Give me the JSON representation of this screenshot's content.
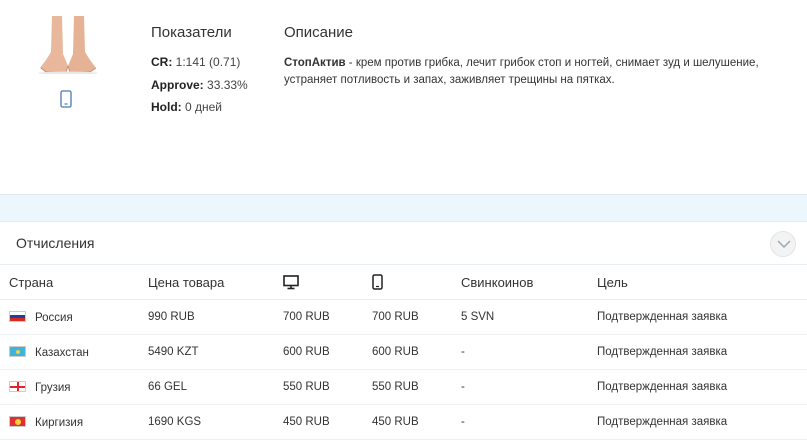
{
  "metrics": {
    "title": "Показатели",
    "cr_label": "CR:",
    "cr_value": "1:141 (0.71)",
    "approve_label": "Approve:",
    "approve_value": "33.33%",
    "hold_label": "Hold:",
    "hold_value": "0 дней"
  },
  "description": {
    "title": "Описание",
    "product_name": "СтопАктив",
    "text": " - крем против грибка, лечит грибок стоп и ногтей, снимает зуд и шелушение, устраняет потливость и запах, заживляет трещины на пятках."
  },
  "icons": {
    "device_top": "mobile-icon",
    "collapse": "chevron-down-icon",
    "desktop": "desktop-icon",
    "mobile": "mobile-icon"
  },
  "payouts": {
    "title": "Отчисления",
    "headers": {
      "country": "Страна",
      "price": "Цена товара",
      "coins": "Свинкоинов",
      "goal": "Цель"
    },
    "rows": [
      {
        "flag": "ru",
        "country": "Россия",
        "price": "990 RUB",
        "desktop": "700 RUB",
        "mobile": "700 RUB",
        "coins": "5 SVN",
        "goal": "Подтвержденная заявка"
      },
      {
        "flag": "kz",
        "country": "Казахстан",
        "price": "5490 KZT",
        "desktop": "600 RUB",
        "mobile": "600 RUB",
        "coins": "-",
        "goal": "Подтвержденная заявка"
      },
      {
        "flag": "ge",
        "country": "Грузия",
        "price": "66 GEL",
        "desktop": "550 RUB",
        "mobile": "550 RUB",
        "coins": "-",
        "goal": "Подтвержденная заявка"
      },
      {
        "flag": "kg",
        "country": "Киргизия",
        "price": "1690 KGS",
        "desktop": "450 RUB",
        "mobile": "450 RUB",
        "coins": "-",
        "goal": "Подтвержденная заявка"
      }
    ]
  }
}
